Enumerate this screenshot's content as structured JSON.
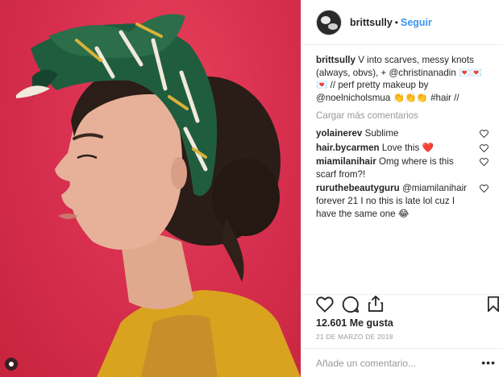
{
  "post": {
    "username": "brittsully",
    "follow_label": "Seguir",
    "separator": "•"
  },
  "caption": {
    "username": "brittsully",
    "text_1": " V into scarves, messy knots (always, obvs), + @christinanadin ",
    "emoji_hearts": "💌💌💌",
    "text_2": " // perf pretty makeup by @noelnicholsmua ",
    "emoji_hands": "👏👏👏",
    "text_3": " #hair //"
  },
  "load_more_label": "Cargar más comentarios",
  "comments": [
    {
      "username": "yolainerev",
      "text": " Sublime"
    },
    {
      "username": "hair.bycarmen",
      "text": " Love this ",
      "emoji": "❤️"
    },
    {
      "username": "miamilanihair",
      "text": " Omg where is this scarf from?!"
    },
    {
      "username": "ruruthebeautyguru",
      "text": " @miamilanihair forever 21 I no this is late lol cuz I have the same one ",
      "emoji": "😂"
    }
  ],
  "likes_label": "12.601 Me gusta",
  "date_label": "21 DE MARZO DE 2018",
  "comment_input": {
    "placeholder": "Añade un comentario...",
    "value": ""
  },
  "icons": [
    "like-heart-icon",
    "comment-icon",
    "share-icon",
    "bookmark-icon",
    "more-options-icon",
    "gallery-badge-icon",
    "comment-heart-icon"
  ],
  "colors": {
    "accent": "#3897f0",
    "muted": "#999999",
    "text": "#262626",
    "photo_background": "#d93050"
  }
}
